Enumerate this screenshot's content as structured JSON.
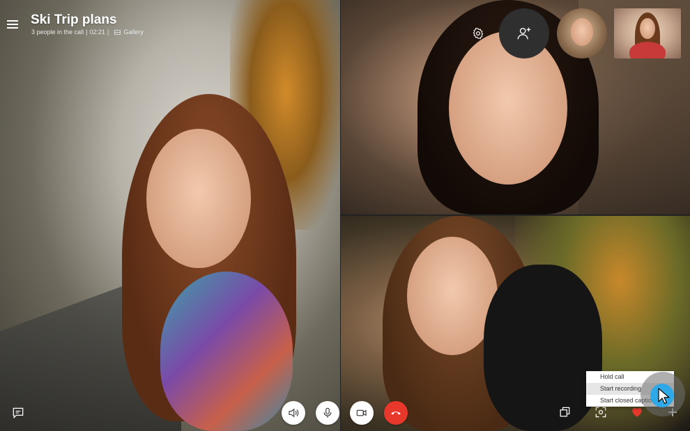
{
  "call": {
    "title": "Ski Trip plans",
    "participants_text": "3 people in the call",
    "duration": "02:21",
    "view_mode": "Gallery",
    "separator": "|"
  },
  "context_menu": {
    "items": [
      "Hold call",
      "Start recording",
      "Start closed captions"
    ],
    "highlighted_index": 1
  },
  "icons": {
    "menu": "hamburger-icon",
    "gallery": "gallery-icon",
    "settings": "gear-icon",
    "add_people": "add-person-icon",
    "speaker": "speaker-icon",
    "microphone": "microphone-icon",
    "video": "video-camera-icon",
    "end_call": "hang-up-icon",
    "chat": "chat-icon",
    "switch_camera": "switch-camera-icon",
    "screenshot": "screenshot-icon",
    "heart": "heart-icon",
    "more": "plus-icon"
  },
  "colors": {
    "end_call": "#e8382c",
    "add_people_bg": "#2f2f2f",
    "pointer": "#2fa8e8",
    "heart": "#e8382c"
  }
}
